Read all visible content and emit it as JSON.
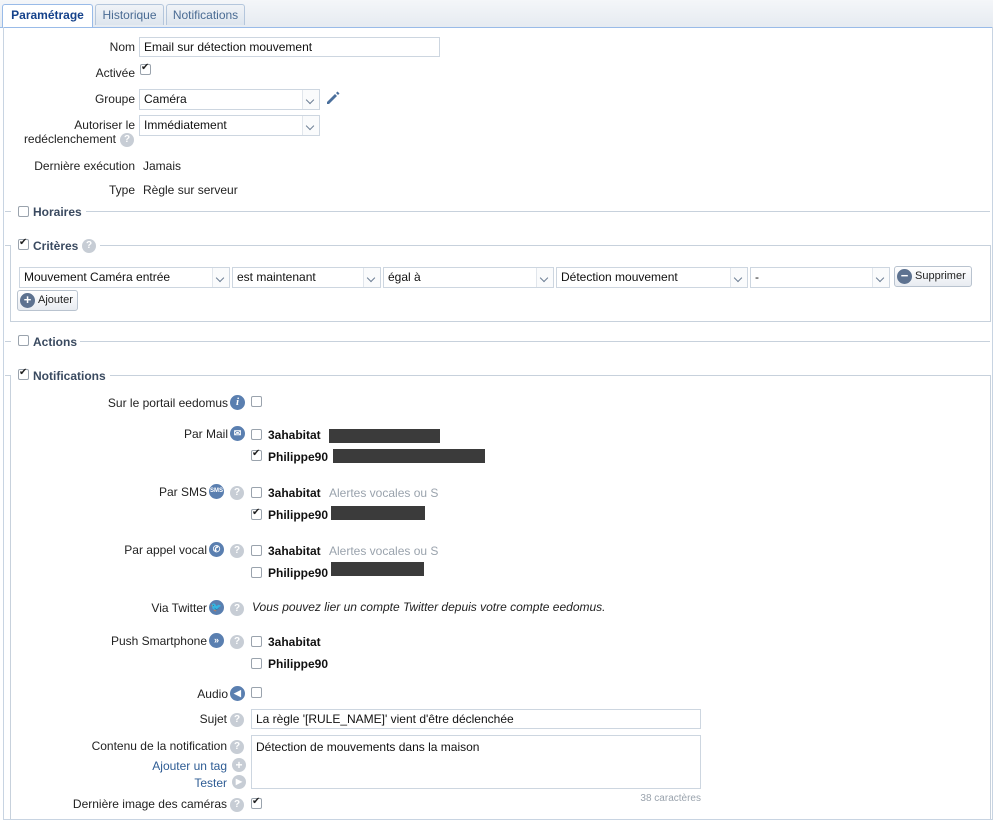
{
  "tabs": [
    "Paramétrage",
    "Historique",
    "Notifications"
  ],
  "form": {
    "nom_label": "Nom",
    "nom_value": "Email sur détection mouvement",
    "activee_label": "Activée",
    "groupe_label": "Groupe",
    "groupe_value": "Caméra",
    "autoriser_label1": "Autoriser le",
    "autoriser_label2": "redéclenchement",
    "autoriser_value": "Immédiatement",
    "derniere_label": "Dernière exécution",
    "derniere_value": "Jamais",
    "type_label": "Type",
    "type_value": "Règle sur serveur"
  },
  "sections": {
    "horaires": "Horaires",
    "criteres": "Critères",
    "actions": "Actions",
    "notifications": "Notifications"
  },
  "criteria": {
    "field": "Mouvement Caméra entrée",
    "time": "est maintenant",
    "operator": "égal à",
    "value": "Détection mouvement",
    "extra": "-",
    "delete_label": "Supprimer",
    "add_label": "Ajouter"
  },
  "notif": {
    "portail_label": "Sur le portail eedomus",
    "mail_label": "Par Mail",
    "sms_label": "Par SMS",
    "appel_label": "Par appel vocal",
    "twitter_label": "Via Twitter",
    "twitter_text": "Vous pouvez lier un compte Twitter depuis votre compte eedomus.",
    "push_label": "Push Smartphone",
    "audio_label": "Audio",
    "sujet_label": "Sujet",
    "sujet_value": "La règle '[RULE_NAME]' vient d'être déclenchée",
    "contenu_label": "Contenu de la notification",
    "contenu_value": "Détection de mouvements dans la maison",
    "ajouter_tag": "Ajouter un tag",
    "tester": "Tester",
    "char_count": "38 caractères",
    "image_label": "Dernière image des caméras",
    "user1": "3ahabitat",
    "user2": "Philippe90",
    "vocal_hint": "Alertes vocales ou S"
  }
}
